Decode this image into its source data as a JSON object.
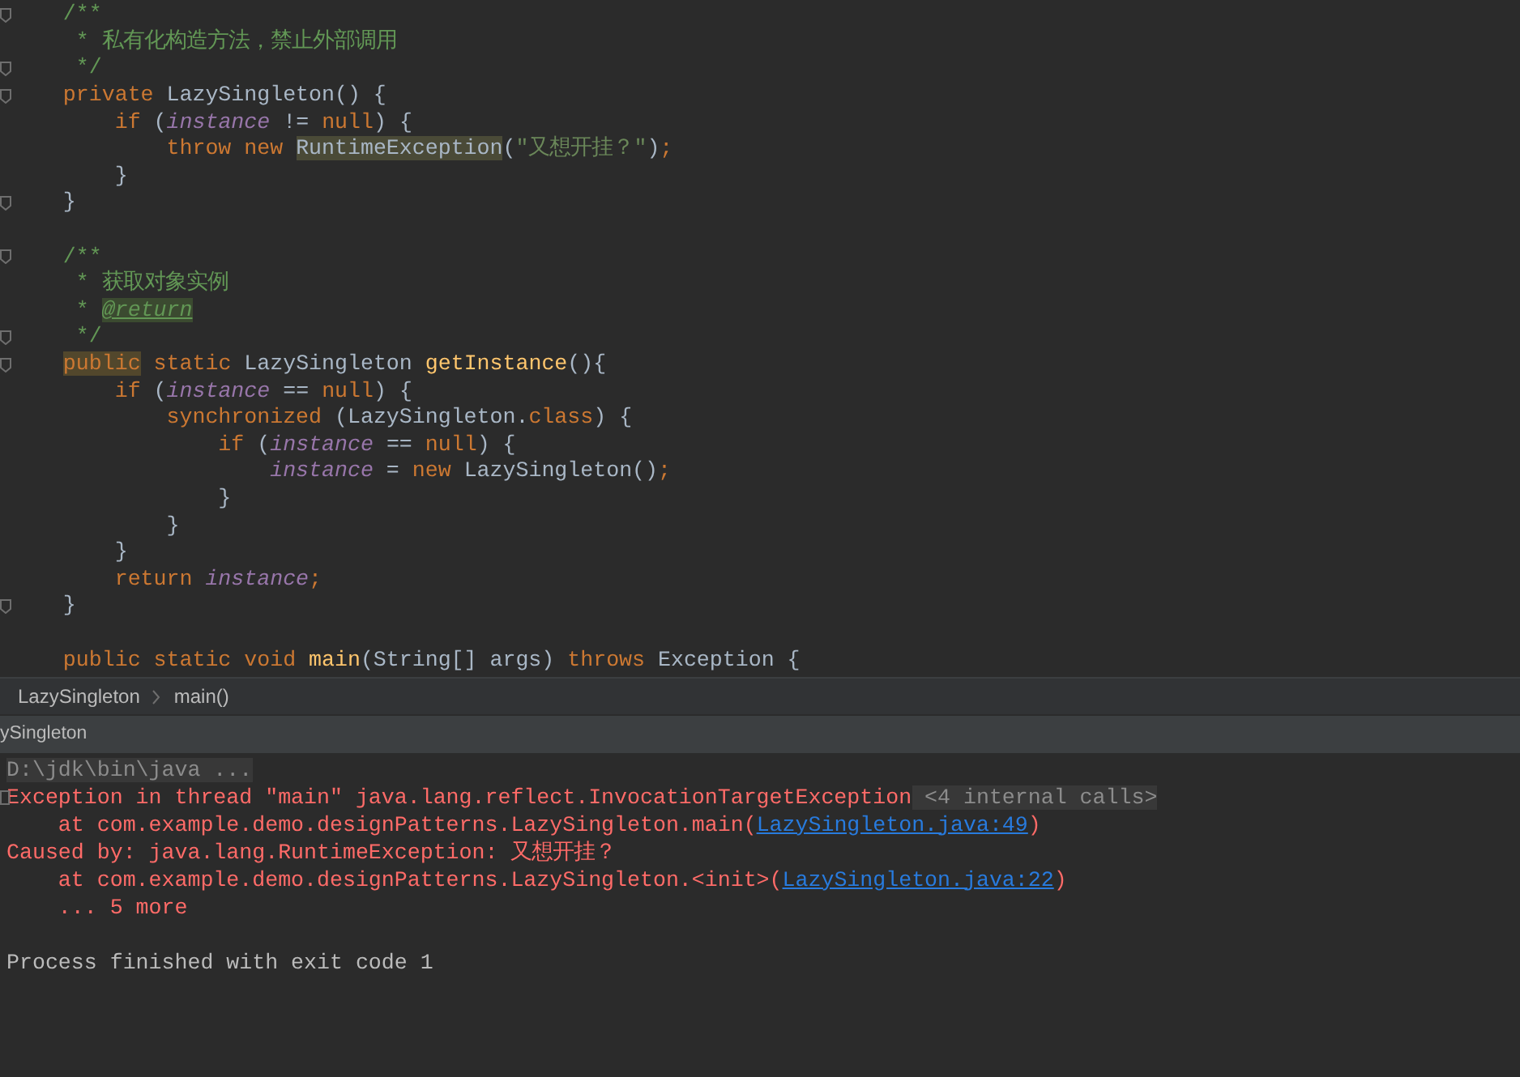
{
  "editor": {
    "lines": [
      {
        "fold": true,
        "tokens": [
          {
            "kind": "comment",
            "text": "    /**"
          }
        ]
      },
      {
        "fold": false,
        "tokens": [
          {
            "kind": "comment",
            "text": "     * 私有化构造方法，禁止外部调用"
          }
        ]
      },
      {
        "fold": true,
        "tokens": [
          {
            "kind": "comment",
            "text": "     */"
          }
        ]
      },
      {
        "fold": true,
        "tokens": [
          {
            "kind": "keyword",
            "text": "    private "
          },
          {
            "kind": "plain",
            "text": "LazySingleton() {"
          }
        ]
      },
      {
        "fold": false,
        "tokens": [
          {
            "kind": "keyword",
            "text": "        if "
          },
          {
            "kind": "plain",
            "text": "("
          },
          {
            "kind": "field",
            "text": "instance"
          },
          {
            "kind": "plain",
            "text": " != "
          },
          {
            "kind": "keyword",
            "text": "null"
          },
          {
            "kind": "plain",
            "text": ") {"
          }
        ]
      },
      {
        "fold": false,
        "tokens": [
          {
            "kind": "keyword",
            "text": "            throw new "
          },
          {
            "kind": "class_marked",
            "text": "RuntimeException"
          },
          {
            "kind": "plain",
            "text": "("
          },
          {
            "kind": "string",
            "text": "\"又想开挂？\""
          },
          {
            "kind": "plain",
            "text": ")"
          },
          {
            "kind": "keyword",
            "text": ";"
          }
        ]
      },
      {
        "fold": false,
        "tokens": [
          {
            "kind": "plain",
            "text": "        }"
          }
        ]
      },
      {
        "fold": true,
        "tokens": [
          {
            "kind": "plain",
            "text": "    }"
          }
        ]
      },
      {
        "fold": false
      },
      {
        "fold": true,
        "tokens": [
          {
            "kind": "comment",
            "text": "    /**"
          }
        ]
      },
      {
        "fold": false,
        "tokens": [
          {
            "kind": "comment",
            "text": "     * 获取对象实例"
          }
        ]
      },
      {
        "fold": false,
        "tokens": [
          {
            "kind": "comment",
            "text": "     * "
          },
          {
            "kind": "doc_tag",
            "text": "@return"
          }
        ]
      },
      {
        "fold": true,
        "tokens": [
          {
            "kind": "comment",
            "text": "     */"
          }
        ]
      },
      {
        "fold": true,
        "tokens": [
          {
            "kind": "keyword_marked",
            "text": "    public"
          },
          {
            "kind": "keyword",
            "text": " static "
          },
          {
            "kind": "plain",
            "text": "LazySingleton "
          },
          {
            "kind": "method",
            "text": "getInstance"
          },
          {
            "kind": "plain",
            "text": "(){"
          }
        ]
      },
      {
        "fold": false,
        "tokens": [
          {
            "kind": "keyword",
            "text": "        if "
          },
          {
            "kind": "plain",
            "text": "("
          },
          {
            "kind": "field",
            "text": "instance"
          },
          {
            "kind": "plain",
            "text": " == "
          },
          {
            "kind": "keyword",
            "text": "null"
          },
          {
            "kind": "plain",
            "text": ") {"
          }
        ]
      },
      {
        "fold": false,
        "tokens": [
          {
            "kind": "keyword",
            "text": "            synchronized "
          },
          {
            "kind": "plain",
            "text": "(LazySingleton."
          },
          {
            "kind": "keyword",
            "text": "class"
          },
          {
            "kind": "plain",
            "text": ") {"
          }
        ]
      },
      {
        "fold": false,
        "tokens": [
          {
            "kind": "keyword",
            "text": "                if "
          },
          {
            "kind": "plain",
            "text": "("
          },
          {
            "kind": "field",
            "text": "instance"
          },
          {
            "kind": "plain",
            "text": " == "
          },
          {
            "kind": "keyword",
            "text": "null"
          },
          {
            "kind": "plain",
            "text": ") {"
          }
        ]
      },
      {
        "fold": false,
        "tokens": [
          {
            "kind": "field",
            "text": "                    instance"
          },
          {
            "kind": "plain",
            "text": " = "
          },
          {
            "kind": "keyword",
            "text": "new "
          },
          {
            "kind": "plain",
            "text": "LazySingleton()"
          },
          {
            "kind": "keyword",
            "text": ";"
          }
        ]
      },
      {
        "fold": false,
        "tokens": [
          {
            "kind": "plain",
            "text": "                }"
          }
        ]
      },
      {
        "fold": false,
        "tokens": [
          {
            "kind": "plain",
            "text": "            }"
          }
        ]
      },
      {
        "fold": false,
        "tokens": [
          {
            "kind": "plain",
            "text": "        }"
          }
        ]
      },
      {
        "fold": false,
        "tokens": [
          {
            "kind": "keyword",
            "text": "        return "
          },
          {
            "kind": "field",
            "text": "instance"
          },
          {
            "kind": "keyword",
            "text": ";"
          }
        ]
      },
      {
        "fold": true,
        "tokens": [
          {
            "kind": "plain",
            "text": "    }"
          }
        ]
      },
      {
        "fold": false
      },
      {
        "fold": false,
        "tokens": [
          {
            "kind": "keyword",
            "text": "    public static void "
          },
          {
            "kind": "method",
            "text": "main"
          },
          {
            "kind": "plain",
            "text": "(String[] args) "
          },
          {
            "kind": "keyword",
            "text": "throws "
          },
          {
            "kind": "plain",
            "text": "Exception {"
          }
        ]
      }
    ]
  },
  "breadcrumb": [
    "LazySingleton",
    "main()"
  ],
  "run_panel": {
    "tab_title": "ySingleton",
    "console_lines": [
      {
        "fold": false,
        "tokens": [
          {
            "kind": "command",
            "text": "D:\\jdk\\bin\\java ..."
          }
        ]
      },
      {
        "fold": true,
        "tokens": [
          {
            "kind": "error",
            "text": "Exception in thread \"main\" java.lang.reflect.InvocationTargetException"
          },
          {
            "kind": "collapsed",
            "text": " <4 internal calls>"
          }
        ]
      },
      {
        "fold": false,
        "tokens": [
          {
            "kind": "error",
            "text": "    at com.example.demo.designPatterns.LazySingleton.main("
          },
          {
            "kind": "link",
            "text": "LazySingleton.java:49"
          },
          {
            "kind": "error",
            "text": ")"
          }
        ]
      },
      {
        "fold": false,
        "tokens": [
          {
            "kind": "error",
            "text": "Caused by: java.lang.RuntimeException: 又想开挂？"
          }
        ]
      },
      {
        "fold": false,
        "tokens": [
          {
            "kind": "error",
            "text": "    at com.example.demo.designPatterns.LazySingleton.<init>("
          },
          {
            "kind": "link",
            "text": "LazySingleton.java:22"
          },
          {
            "kind": "error",
            "text": ")"
          }
        ]
      },
      {
        "fold": false,
        "tokens": [
          {
            "kind": "error",
            "text": "    ... 5 more"
          }
        ]
      },
      {
        "fold": false
      },
      {
        "fold": false,
        "tokens": [
          {
            "kind": "output",
            "text": "Process finished with exit code 1"
          }
        ]
      }
    ]
  }
}
